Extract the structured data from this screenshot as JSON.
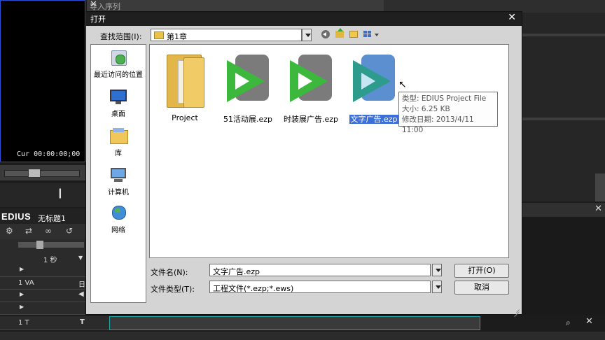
{
  "background": {
    "timecode": "Cur 00:00:00;00",
    "import_sequence_title": "导入序列",
    "app_logo": "EDIUS",
    "project_title": "无标题1",
    "timeline_scale": "1 秒",
    "track_1va": "1 VA",
    "track_1va_side": "日",
    "track_1t": "1 T",
    "track_1t_side": "T"
  },
  "dialog": {
    "title": "打开",
    "look_in_label": "查找范围(I):",
    "look_in_value": "第1章",
    "places": [
      {
        "label": "最近访问的位置",
        "icon": "recent-places-icon"
      },
      {
        "label": "桌面",
        "icon": "desktop-icon"
      },
      {
        "label": "库",
        "icon": "libraries-icon"
      },
      {
        "label": "计算机",
        "icon": "computer-icon"
      },
      {
        "label": "网络",
        "icon": "network-icon"
      }
    ],
    "files": [
      {
        "name": "Project",
        "icon": "folder-icon"
      },
      {
        "name": "51活动展.ezp",
        "icon": "edius-project-icon"
      },
      {
        "name": "时装展广告.ezp",
        "icon": "edius-project-icon"
      },
      {
        "name": "文字广告.ezp",
        "icon": "edius-project-icon",
        "selected": true
      }
    ],
    "tooltip": {
      "type": "类型: EDIUS Project File",
      "size": "大小: 6.25 KB",
      "modified": "修改日期: 2013/4/11 11:00"
    },
    "filename_label": "文件名(N):",
    "filename_value": "文字广告.ezp",
    "filetype_label": "文件类型(T):",
    "filetype_value": "工程文件(*.ezp;*.ews)",
    "open_button": "打开(O)",
    "cancel_button": "取消"
  },
  "colors": {
    "selection": "#3d6fd8",
    "edius_green": "#3cb83c",
    "titlebar": "#1f1f1f"
  }
}
